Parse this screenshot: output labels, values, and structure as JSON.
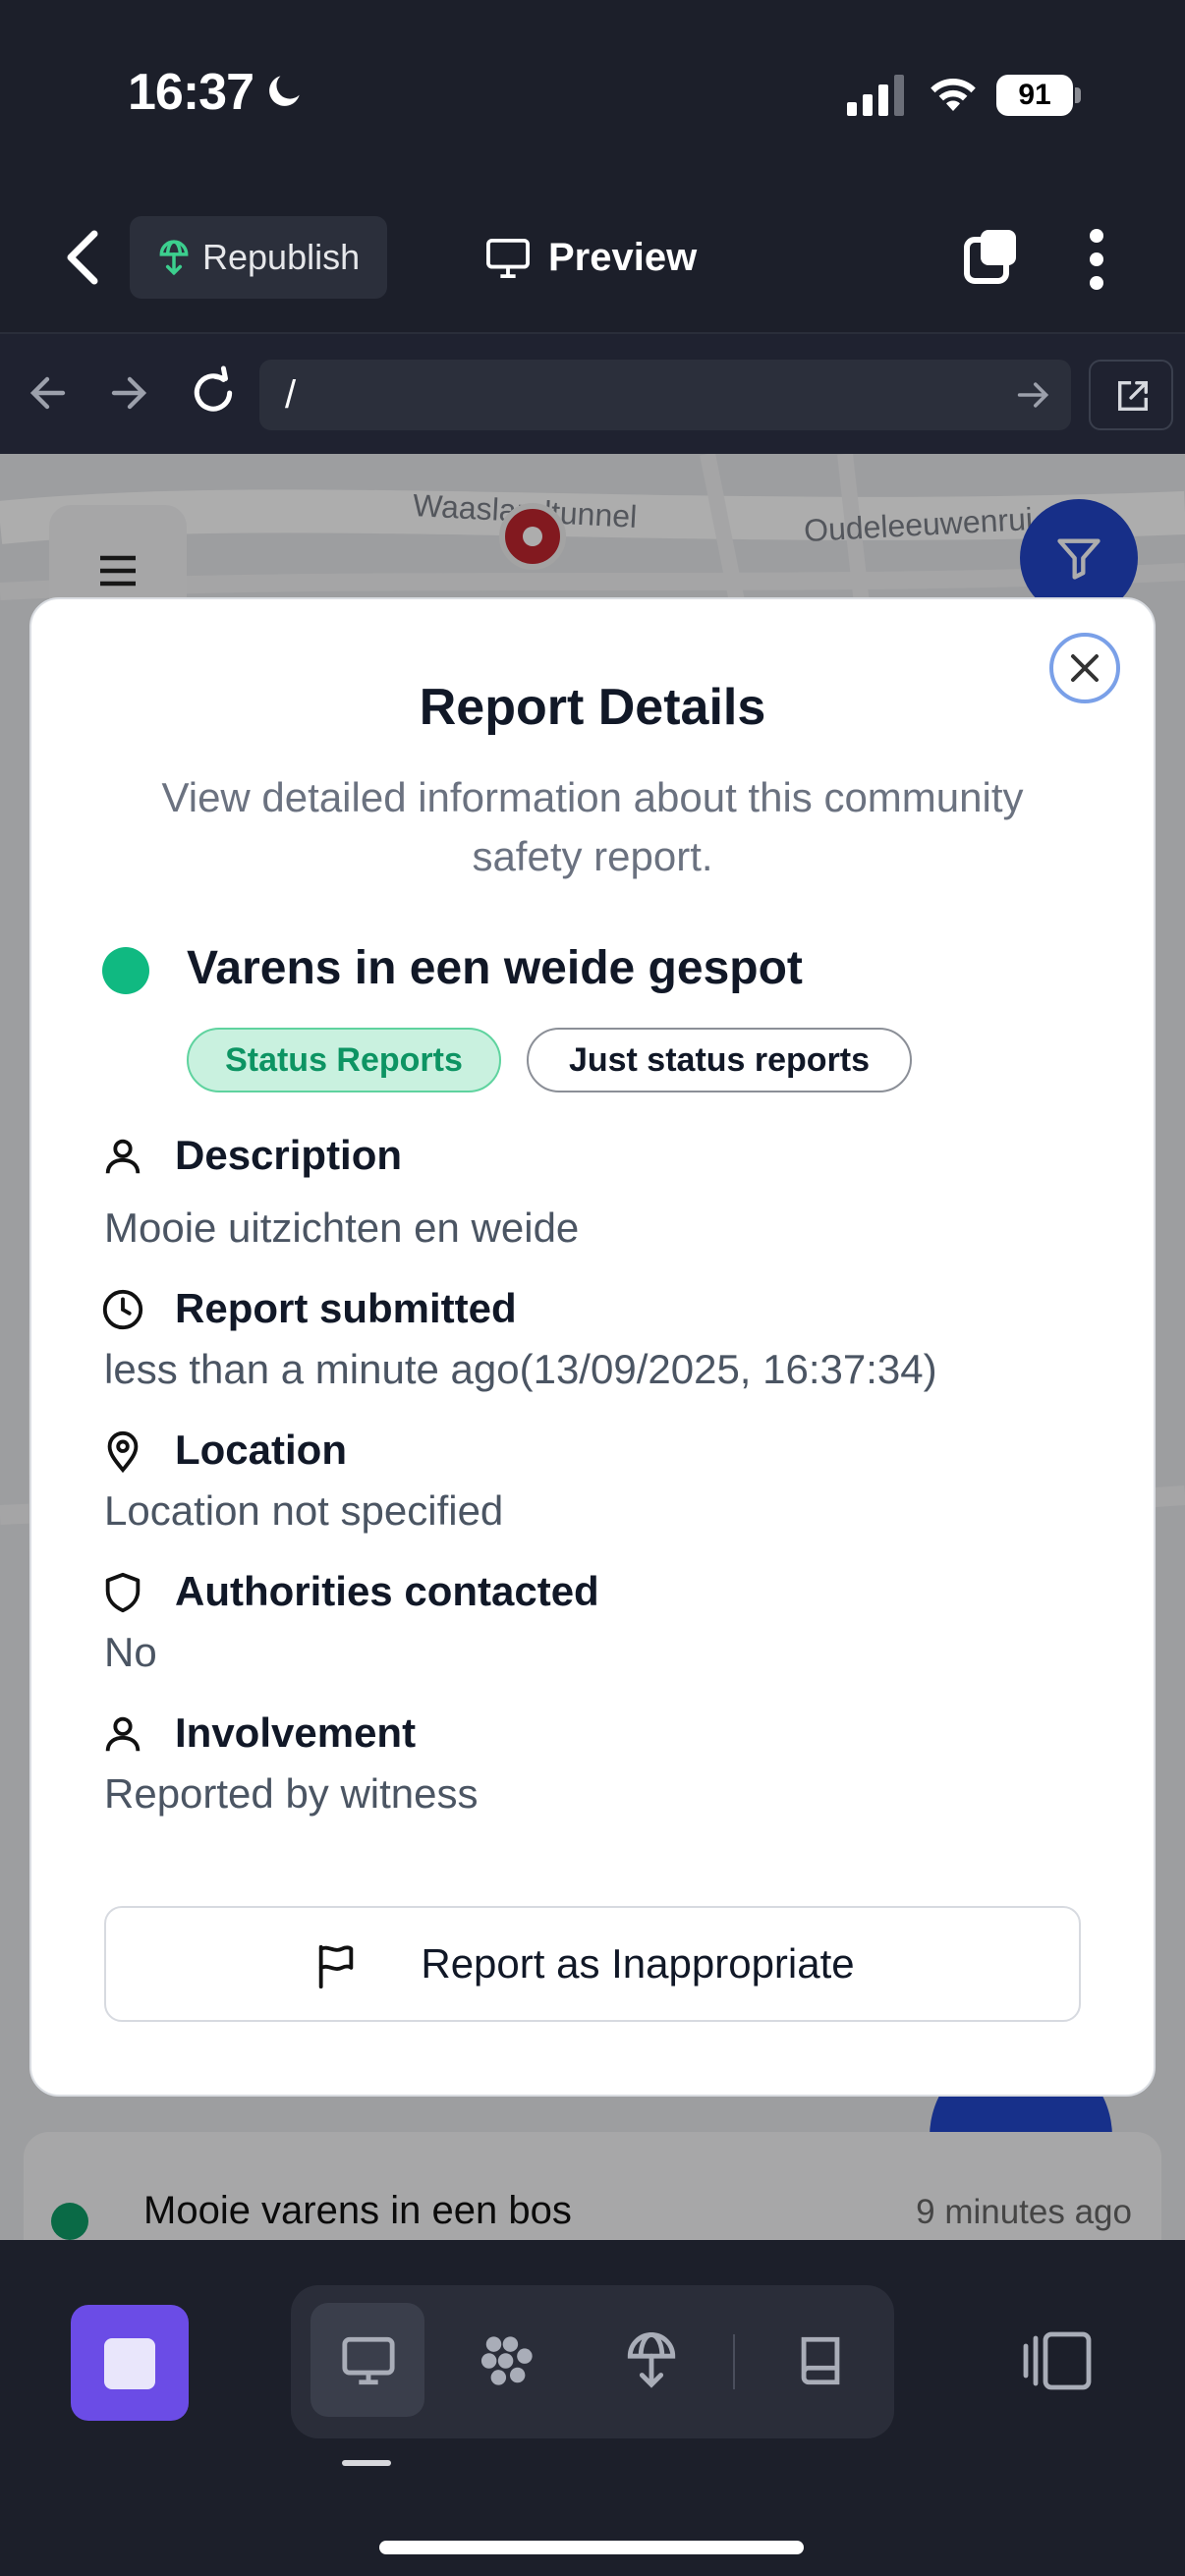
{
  "status_bar": {
    "time": "16:37",
    "battery": "91"
  },
  "toolbar": {
    "republish_label": "Republish",
    "preview_label": "Preview"
  },
  "address_bar": {
    "url": "/"
  },
  "map": {
    "labels": [
      "Waaslandtunnel",
      "Oudeleeuwenrui"
    ]
  },
  "modal": {
    "title": "Report Details",
    "subtitle": "View detailed information about this community safety report.",
    "report_title": "Varens in een weide gespot",
    "badges": [
      "Status Reports",
      "Just status reports"
    ],
    "details": [
      {
        "icon": "user-icon",
        "label": "Description",
        "value": "Mooie uitzichten en weide"
      },
      {
        "icon": "clock-icon",
        "label": "Report submitted",
        "value": "less than a minute ago(13/09/2025, 16:37:34)"
      },
      {
        "icon": "map-pin-icon",
        "label": "Location",
        "value": "Location not specified"
      },
      {
        "icon": "shield-icon",
        "label": "Authorities contacted",
        "value": "No"
      },
      {
        "icon": "user-icon",
        "label": "Involvement",
        "value": "Reported by witness"
      }
    ],
    "report_button": "Report as Inappropriate"
  },
  "list": {
    "item_title": "Mooie varens in een bos",
    "item_time": "9 minutes ago"
  },
  "colors": {
    "accent_green": "#10b981",
    "brand_blue": "#2346c9",
    "dock_purple": "#6b4ce6"
  }
}
